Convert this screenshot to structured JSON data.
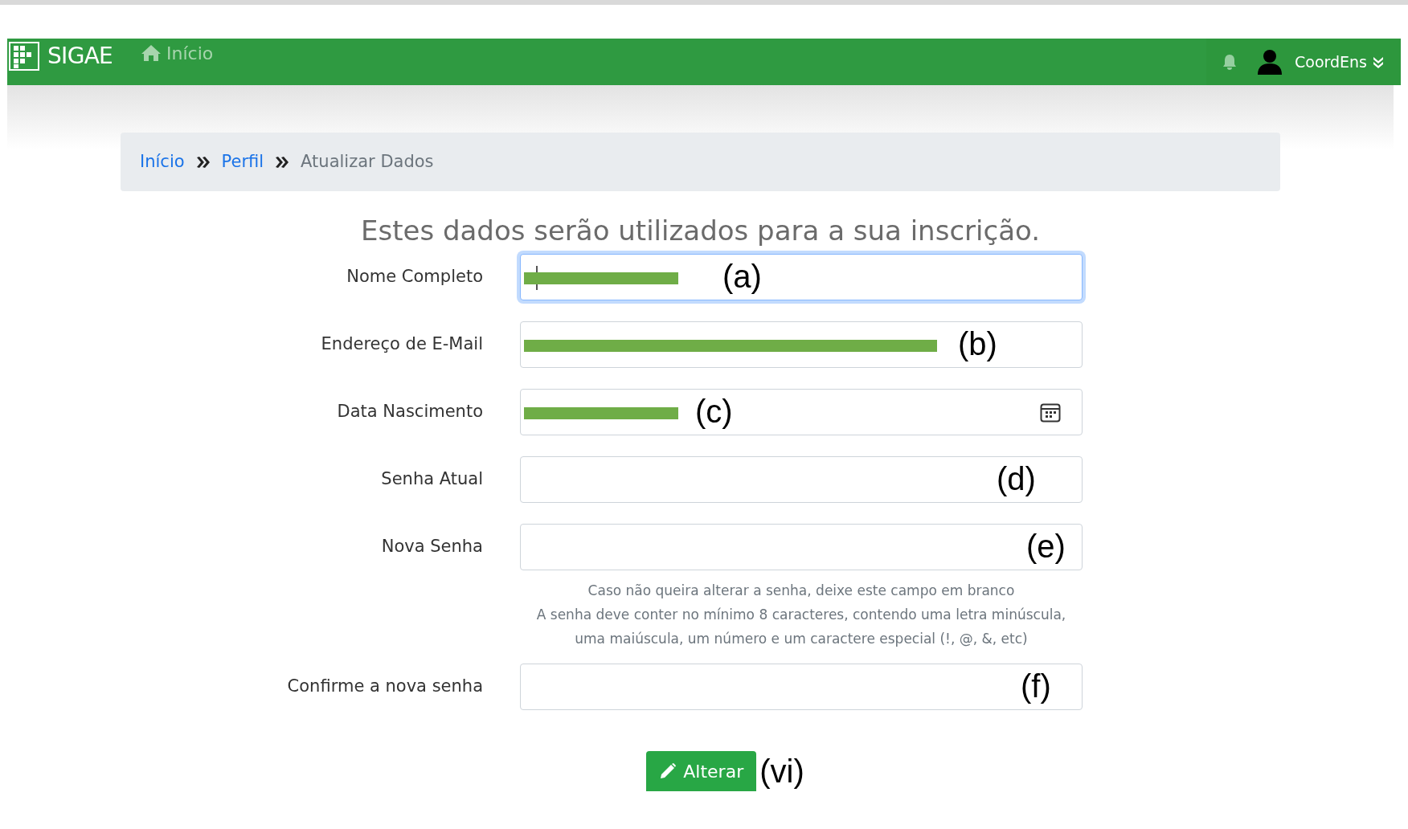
{
  "navbar": {
    "brand": "SIGAE",
    "home_link": "Início",
    "user_name": "CoordEns"
  },
  "breadcrumb": [
    {
      "label": "Início",
      "kind": "link"
    },
    {
      "label": "Perfil",
      "kind": "link"
    },
    {
      "label": "Atualizar Dados",
      "kind": "current"
    }
  ],
  "heading": "Estes dados serão utilizados para a sua inscrição.",
  "fields": [
    {
      "label": "Nome Completo",
      "kind": "text",
      "focused": true,
      "redacted": true,
      "annotation": "(a)"
    },
    {
      "label": "Endereço de E-Mail",
      "kind": "email",
      "focused": false,
      "redacted": true,
      "annotation": "(b)"
    },
    {
      "label": "Data Nascimento",
      "kind": "date",
      "focused": false,
      "redacted": true,
      "annotation": "(c)"
    },
    {
      "label": "Senha Atual",
      "kind": "password",
      "focused": false,
      "annotation": "(d)"
    },
    {
      "label": "Nova Senha",
      "kind": "password",
      "focused": false,
      "annotation": "(e)",
      "help": [
        "Caso não queira alterar a senha, deixe este campo em branco",
        "A senha deve conter no mínimo 8 caracteres, contendo uma letra minúscula, uma maiúscula, um número e um caractere especial (!, @, &, etc)"
      ]
    },
    {
      "label": "Confirme a nova senha",
      "kind": "password",
      "focused": false,
      "annotation": "(f)"
    }
  ],
  "submit": {
    "label": "Alterar",
    "annotation": "(vi)"
  }
}
